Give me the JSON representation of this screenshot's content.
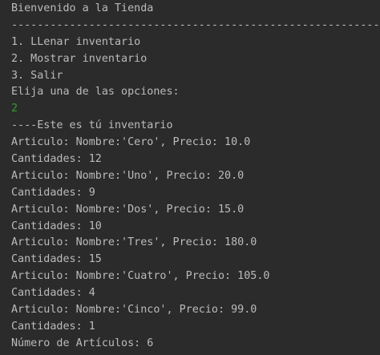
{
  "console": {
    "colors": {
      "background": "#2b2b2b",
      "output_text": "#bbbbbb",
      "user_input": "#2f9e2f"
    },
    "lines": [
      {
        "text": "Bienvenido a la Tienda",
        "kind": "output"
      },
      {
        "text": "----------------------------------------------------------",
        "kind": "output"
      },
      {
        "text": "1. LLenar inventario",
        "kind": "output"
      },
      {
        "text": "2. Mostrar inventario",
        "kind": "output"
      },
      {
        "text": "3. Salir",
        "kind": "output"
      },
      {
        "text": "Elija una de las opciones:",
        "kind": "output"
      },
      {
        "text": "2",
        "kind": "input"
      },
      {
        "text": "----Este es tú inventario",
        "kind": "output"
      },
      {
        "text": "Articulo: Nombre:'Cero', Precio: 10.0",
        "kind": "output"
      },
      {
        "text": "Cantidades: 12",
        "kind": "output"
      },
      {
        "text": "Articulo: Nombre:'Uno', Precio: 20.0",
        "kind": "output"
      },
      {
        "text": "Cantidades: 9",
        "kind": "output"
      },
      {
        "text": "Articulo: Nombre:'Dos', Precio: 15.0",
        "kind": "output"
      },
      {
        "text": "Cantidades: 10",
        "kind": "output"
      },
      {
        "text": "Articulo: Nombre:'Tres', Precio: 180.0",
        "kind": "output"
      },
      {
        "text": "Cantidades: 15",
        "kind": "output"
      },
      {
        "text": "Articulo: Nombre:'Cuatro', Precio: 105.0",
        "kind": "output"
      },
      {
        "text": "Cantidades: 4",
        "kind": "output"
      },
      {
        "text": "Articulo: Nombre:'Cinco', Precio: 99.0",
        "kind": "output"
      },
      {
        "text": "Cantidades: 1",
        "kind": "output"
      },
      {
        "text": "Número de Artículos: 6",
        "kind": "output"
      }
    ]
  }
}
